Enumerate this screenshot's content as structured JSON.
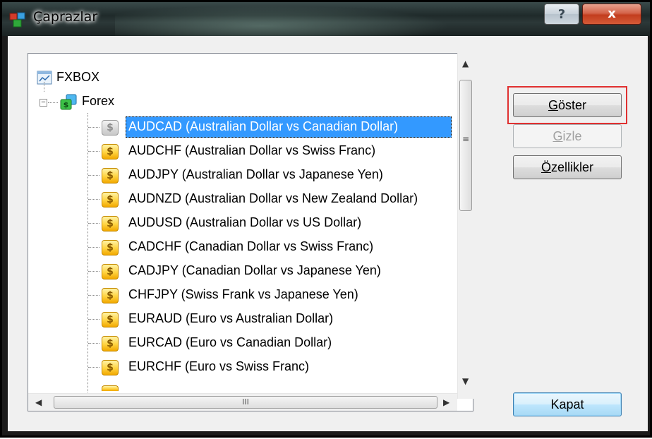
{
  "window": {
    "title": "Çaprazlar",
    "help_label": "?",
    "close_label": "x"
  },
  "tree": {
    "root_label": "FXBOX",
    "folder_label": "Forex",
    "expander_symbol": "−",
    "items": [
      {
        "symbol": "AUDCAD",
        "label": "AUDCAD  (Australian Dollar vs Canadian Dollar)",
        "selected": true
      },
      {
        "symbol": "AUDCHF",
        "label": "AUDCHF  (Australian Dollar vs Swiss Franc)"
      },
      {
        "symbol": "AUDJPY",
        "label": "AUDJPY  (Australian Dollar vs Japanese Yen)"
      },
      {
        "symbol": "AUDNZD",
        "label": "AUDNZD  (Australian Dollar vs New Zealand Dollar)"
      },
      {
        "symbol": "AUDUSD",
        "label": "AUDUSD  (Australian Dollar vs US Dollar)"
      },
      {
        "symbol": "CADCHF",
        "label": "CADCHF  (Canadian Dollar vs Swiss Franc)"
      },
      {
        "symbol": "CADJPY",
        "label": "CADJPY  (Canadian Dollar vs Japanese Yen)"
      },
      {
        "symbol": "CHFJPY",
        "label": "CHFJPY  (Swiss Frank vs Japanese Yen)"
      },
      {
        "symbol": "EURAUD",
        "label": "EURAUD  (Euro vs Australian Dollar)"
      },
      {
        "symbol": "EURCAD",
        "label": "EURCAD  (Euro vs Canadian Dollar)"
      },
      {
        "symbol": "EURCHF",
        "label": "EURCHF  (Euro vs Swiss Franc)"
      }
    ],
    "currency_glyph": "$"
  },
  "buttons": {
    "show": {
      "mnemonic": "G",
      "rest": "öster"
    },
    "hide": {
      "mnemonic": "G",
      "rest": "izle"
    },
    "properties": {
      "mnemonic": "Ö",
      "rest": "zellikler"
    },
    "close": {
      "label": "Kapat"
    }
  },
  "scrollbars": {
    "up": "▲",
    "down": "▼",
    "left": "◀",
    "right": "▶",
    "grip_v": "≡",
    "grip_h": "III"
  },
  "colors": {
    "selection": "#3399ff",
    "highlight_outline": "#e03030"
  }
}
